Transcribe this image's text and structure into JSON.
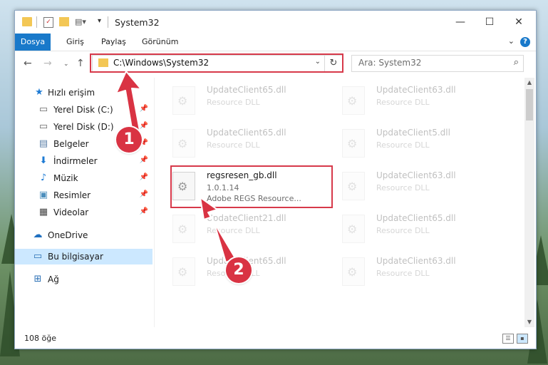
{
  "window": {
    "title": "System32",
    "controls": {
      "minimize": "—",
      "maximize": "☐",
      "close": "✕"
    }
  },
  "ribbon": {
    "tabs": [
      "Dosya",
      "Giriş",
      "Paylaş",
      "Görünüm"
    ],
    "help": "?"
  },
  "address": {
    "path": "C:\\Windows\\System32",
    "search_placeholder": "Ara: System32"
  },
  "sidebar": {
    "items": [
      {
        "label": "Hızlı erişim",
        "icon": "star-icon"
      },
      {
        "label": "Yerel Disk (C:)",
        "icon": "drive-icon",
        "pinned": true
      },
      {
        "label": "Yerel Disk (D:)",
        "icon": "drive-icon",
        "pinned": true
      },
      {
        "label": "Belgeler",
        "icon": "documents-icon",
        "pinned": true
      },
      {
        "label": "İndirmeler",
        "icon": "download-icon",
        "pinned": true
      },
      {
        "label": "Müzik",
        "icon": "music-icon",
        "pinned": true
      },
      {
        "label": "Resimler",
        "icon": "pictures-icon",
        "pinned": true
      },
      {
        "label": "Videolar",
        "icon": "video-icon",
        "pinned": true
      },
      {
        "label": "OneDrive",
        "icon": "cloud-icon"
      },
      {
        "label": "Bu bilgisayar",
        "icon": "computer-icon",
        "selected": true
      },
      {
        "label": "Ağ",
        "icon": "network-icon"
      }
    ]
  },
  "files": {
    "highlighted": {
      "name": "regsresen_gb.dll",
      "version": "1.0.1.14",
      "description": "Adobe REGS Resource..."
    },
    "faded": [
      {
        "name": "UpdateClient65.dll",
        "type": "Resource DLL"
      },
      {
        "name": "UpdateClient63.dll",
        "type": "Resource DLL"
      },
      {
        "name": "UpdateClient65.dll",
        "type": "Resource DLL"
      },
      {
        "name": "UpdateClient5.dll",
        "type": "Resource DLL"
      },
      {
        "name": "UpdateClient63.dll",
        "type": "Resource DLL"
      },
      {
        "name": "UpdateClient21.dll",
        "type": "Resource DLL"
      },
      {
        "name": "UpdateClient65.dll",
        "type": "Resource DLL"
      },
      {
        "name": "UpdateClient65.dll",
        "type": "Resource DLL"
      },
      {
        "name": "UpdateClient63.dll",
        "type": "Resource DLL"
      }
    ]
  },
  "status": {
    "count": "108 öğe"
  },
  "annotations": {
    "step1": "1",
    "step2": "2",
    "color": "#d93343"
  }
}
